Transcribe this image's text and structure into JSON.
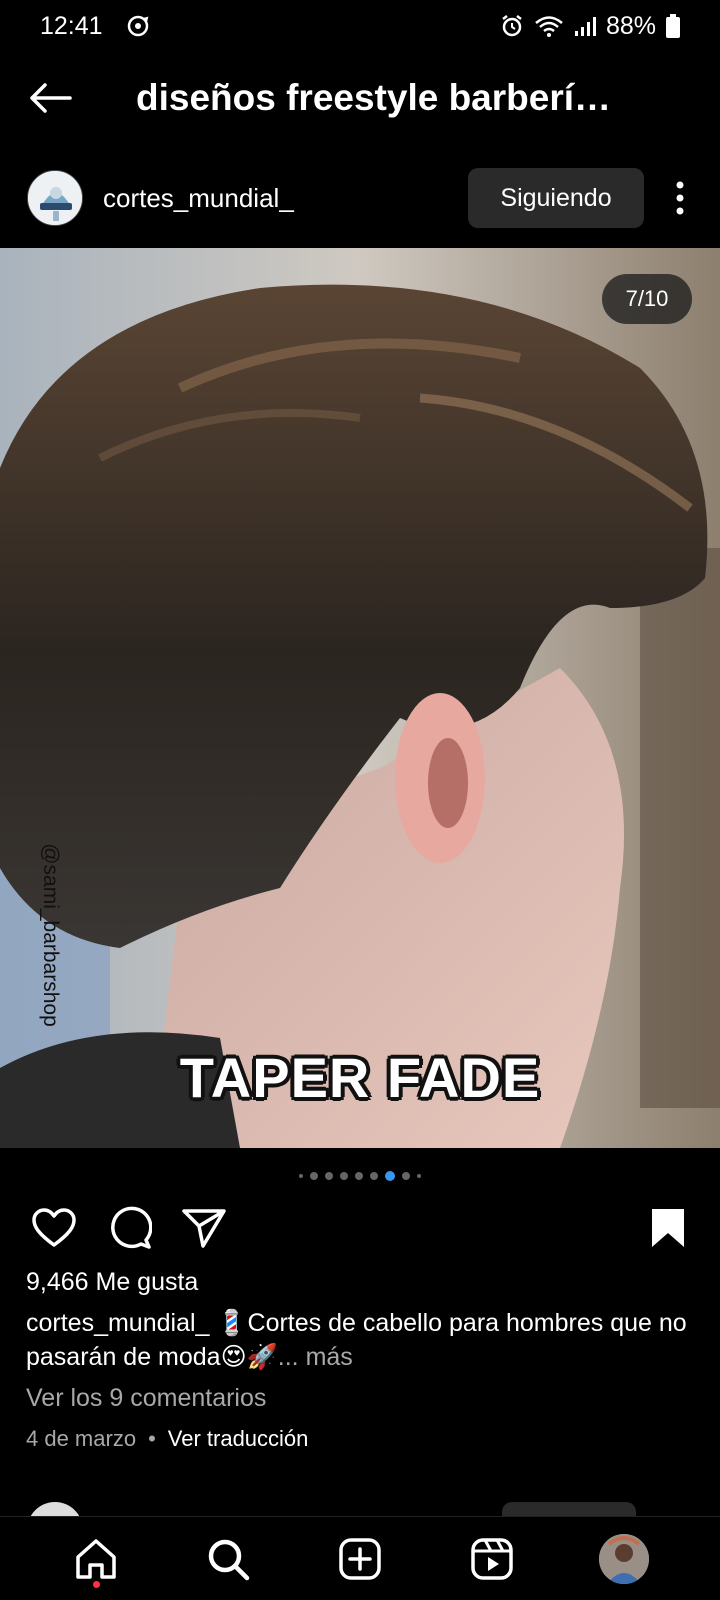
{
  "status_bar": {
    "time": "12:41",
    "battery": "88%",
    "icons": [
      "sync-icon",
      "alarm-icon",
      "wifi-icon",
      "signal-icon",
      "battery-icon"
    ]
  },
  "header": {
    "title": "diseños freestyle barbería ho..."
  },
  "post": {
    "username": "cortes_mundial_",
    "follow_label": "Siguiendo",
    "image_counter": "7/10",
    "watermark": "@sami_barbarshop",
    "overlay_text": "TAPER FADE",
    "carousel": {
      "total_dots": 10,
      "active_index": 6
    },
    "likes": "9,466 Me gusta",
    "caption_user": "cortes_mundial_",
    "caption_text": "💈Cortes de cabello para hombres que no pasarán de moda😍🚀",
    "caption_more": "... más",
    "comments_link": "Ver los 9 comentarios",
    "date": "4 de marzo",
    "separator": "•",
    "translate": "Ver traducción"
  },
  "bottom_nav": {
    "items": [
      "home-icon",
      "search-icon",
      "create-icon",
      "reels-icon",
      "profile-avatar"
    ]
  },
  "colors": {
    "background": "#000000",
    "button": "#2a2a2a",
    "secondary_text": "#a8a8a8",
    "active_dot": "#3897f0",
    "notification": "#ff3040"
  }
}
